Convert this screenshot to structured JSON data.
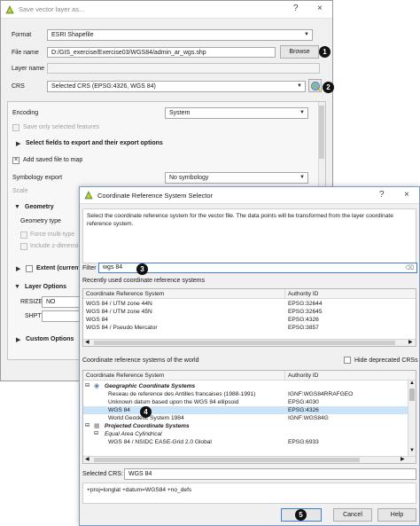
{
  "save_dialog": {
    "title": "Save vector layer as...",
    "help": "?",
    "close": "×",
    "format_label": "Format",
    "format_value": "ESRI Shapefile",
    "filename_label": "File name",
    "filename_value": "D:/GIS_exercise/Exercise03/WGS84/admin_ar_wgs.shp",
    "browse_label": "Browse",
    "layername_label": "Layer name",
    "crs_label": "CRS",
    "crs_value": "Selected CRS (EPSG:4326, WGS 84)",
    "encoding_label": "Encoding",
    "encoding_value": "System",
    "save_selected_label": "Save only selected features",
    "select_fields_label": "Select fields to export and their export options",
    "add_saved_label": "Add saved file to map",
    "symbology_label": "Symbology export",
    "symbology_value": "No symbology",
    "scale_label": "Scale",
    "geometry_label": "Geometry",
    "geometry_type_label": "Geometry type",
    "force_multi_label": "Force multi-type",
    "include_z_label": "Include z-dimension",
    "extent_label": "Extent (current",
    "layer_options_label": "Layer Options",
    "resize_label": "RESIZE",
    "resize_value": "NO",
    "shpt_label": "SHPT",
    "custom_options_label": "Custom Options"
  },
  "crs_dialog": {
    "title": "Coordinate Reference System Selector",
    "help": "?",
    "close": "×",
    "description": "Select the coordinate reference system for the vector file. The data points will be transformed from the layer coordinate reference system.",
    "filter_label": "Filter",
    "filter_value": "wgs 84",
    "recent_label": "Recently used coordinate reference systems",
    "recent_headers": [
      "Coordinate Reference System",
      "Authority ID"
    ],
    "recent_rows": [
      {
        "name": "WGS 84 / UTM zone 44N",
        "id": "EPSG:32644"
      },
      {
        "name": "WGS 84 / UTM zone 45N",
        "id": "EPSG:32645"
      },
      {
        "name": "WGS 84",
        "id": "EPSG:4326"
      },
      {
        "name": "WGS 84 / Pseudo Mercator",
        "id": "EPSG:3857"
      }
    ],
    "world_label": "Coordinate reference systems of the world",
    "hide_deprecated_label": "Hide deprecated CRSs",
    "world_headers": [
      "Coordinate Reference System",
      "Authority ID"
    ],
    "world_rows": [
      {
        "name": "Geographic Coordinate Systems",
        "id": ""
      },
      {
        "name": "Reseau de reference des Antilles francaises (1988-1991)",
        "id": "IGNF:WGS84RRAFGEO"
      },
      {
        "name": "Unknown datum based upon the WGS 84 ellipsoid",
        "id": "EPSG:4030"
      },
      {
        "name": "WGS 84",
        "id": "EPSG:4326"
      },
      {
        "name": "World Geodetic System 1984",
        "id": "IGNF:WGS84G"
      },
      {
        "name": "Projected Coordinate Systems",
        "id": ""
      },
      {
        "name": "Equal Area Cylindrical",
        "id": ""
      },
      {
        "name": "WGS 84 / NSIDC EASE-Grid 2.0 Global",
        "id": "EPSG:6933"
      }
    ],
    "selected_crs_label": "Selected CRS:",
    "selected_crs_value": "WGS 84",
    "proj_string": "+proj=longlat +datum=WGS84 +no_defs",
    "ok_label": "",
    "cancel_label": "Cancel",
    "help_label": "Help"
  },
  "badges": [
    "1",
    "2",
    "3",
    "4",
    "5"
  ],
  "colors": {
    "badge_bg": "#111111",
    "selection_blue": "#cce4f7",
    "filter_border": "#3c7fd2",
    "accent_orange": "#e8a33a"
  }
}
